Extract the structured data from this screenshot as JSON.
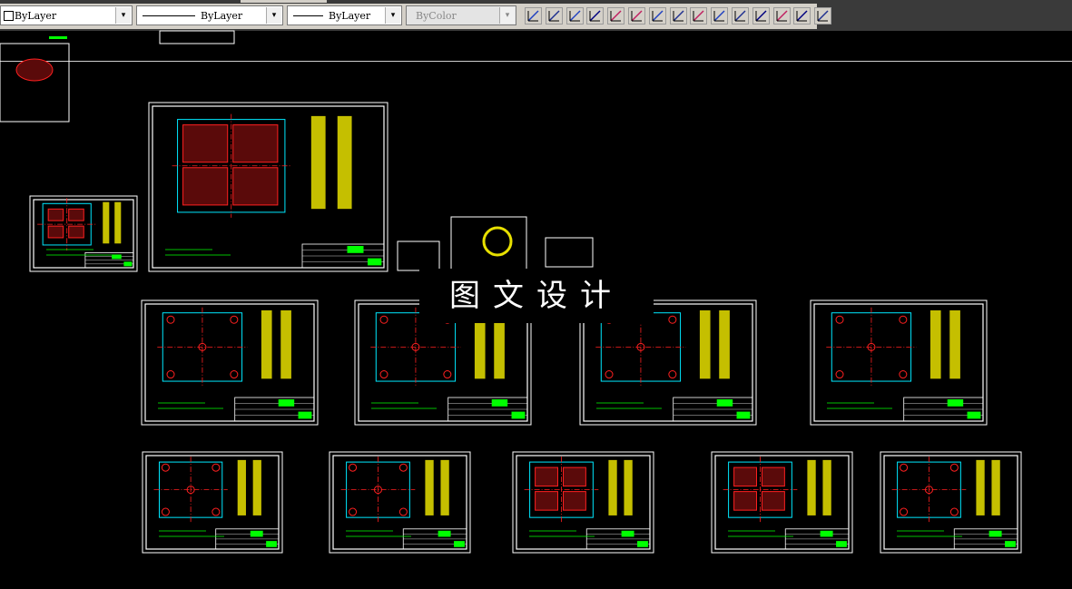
{
  "toolbar": {
    "layer_combo": "ByLayer",
    "linetype_combo": "ByLayer",
    "lineweight_combo": "ByLayer",
    "plotstyle_combo": "ByColor",
    "dropdown_glyph": "▾",
    "dimension_tools": [
      "linear-dimension-icon",
      "aligned-dimension-icon",
      "arc-length-icon",
      "ordinate-icon",
      "radius-icon",
      "jogged-icon",
      "diameter-icon",
      "angular-icon",
      "quick-dimension-icon",
      "baseline-icon",
      "continue-icon",
      "dim-space-icon",
      "dim-break-icon",
      "tolerance-icon",
      "center-mark-icon"
    ]
  },
  "watermark": {
    "text": "图文设计"
  },
  "colors": {
    "background": "#000000",
    "sheet_border": "#ffffff",
    "geometry_yellow": "#e8e000",
    "geometry_red": "#ff2020",
    "geometry_cyan": "#00e8ff",
    "geometry_green": "#00ff00"
  }
}
